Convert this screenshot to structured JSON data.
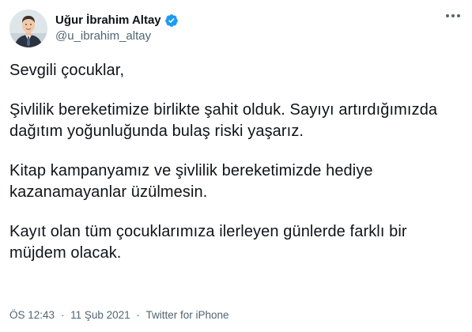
{
  "author": {
    "display_name": "Uğur İbrahim Altay",
    "handle": "@u_ibrahim_altay",
    "verified_icon": "verified-badge-icon",
    "verified_color": "#1d9bf0"
  },
  "tweet": {
    "paragraphs": [
      "Sevgili çocuklar,",
      "Şivlilik bereketimize birlikte şahit olduk. Sayıyı artırdığımızda dağıtım yoğunluğunda bulaş riski yaşarız.",
      "Kitap kampanyamız ve şivlilik bereketimizde hediye kazanamayanlar üzülmesin.",
      "Kayıt olan tüm çocuklarımıza ilerleyen günlerde farklı bir müjdem olacak."
    ]
  },
  "meta": {
    "time": "ÖS 12:43",
    "date": "11 Şub 2021",
    "source": "Twitter for iPhone",
    "separator": "·"
  },
  "menu": {
    "icon": "more-options-icon"
  }
}
